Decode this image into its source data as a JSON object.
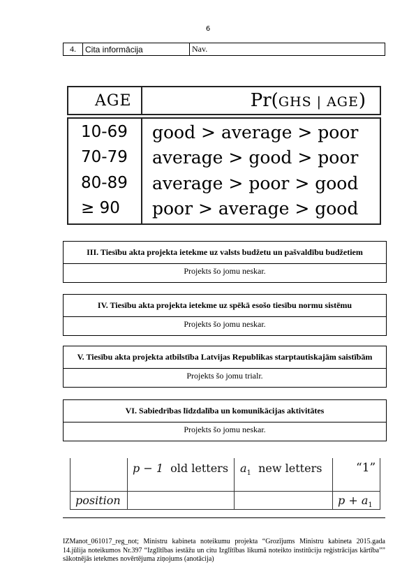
{
  "page_number": "6",
  "info_row": {
    "num": "4.",
    "label": "Cita informācija",
    "value": "Nav."
  },
  "age_figure": {
    "header_age": "AGE",
    "header_pr_prefix": "Pr(",
    "header_pr_ghs": "GHS | AGE",
    "header_pr_suffix": ")",
    "rows": [
      {
        "age": "10-69",
        "order": "good > average > poor"
      },
      {
        "age": "70-79",
        "order": "average > good > poor"
      },
      {
        "age": "80-89",
        "order": "average > poor > good"
      },
      {
        "age": "≥ 90",
        "order": "poor > average > good"
      }
    ]
  },
  "sections": [
    {
      "title": "III. Tiesību akta projekta ietekme uz valsts budžetu un pašvaldību budžetiem",
      "content": "Projekts šo jomu neskar."
    },
    {
      "title": "IV. Tiesību akta projekta ietekme uz spēkā esošo tiesību normu sistēmu",
      "content": "Projekts šo jomu neskar."
    },
    {
      "title": "V. Tiesību akta projekta atbilstība Latvijas Republikas starptautiskajām saistībām",
      "content": "Projekts šo jomu trialr."
    },
    {
      "title": "VI. Sabiedrības līdzdalība un komunikācijas aktivitātes",
      "content": "Projekts šo jomu neskar."
    }
  ],
  "letters_figure": {
    "col1_a": "p − 1",
    "col1_b": "old letters",
    "col2_a": "a",
    "col2_sub": "1",
    "col2_b": "new letters",
    "col3": "“1”",
    "row_label": "position",
    "cell3_a": "p + a",
    "cell3_sub": "1"
  },
  "footer": "IZManot_061017_reg_not; Ministru kabineta noteikumu projekta “Grozījums Ministru kabineta 2015.gada 14.jūlija noteikumos Nr.397 “Izglītības iestāžu un citu Izglītības likumā noteikto institūciju reģistrācijas kārtība”” sākotnējās ietekmes novērtējuma ziņojums (anotācija)"
}
